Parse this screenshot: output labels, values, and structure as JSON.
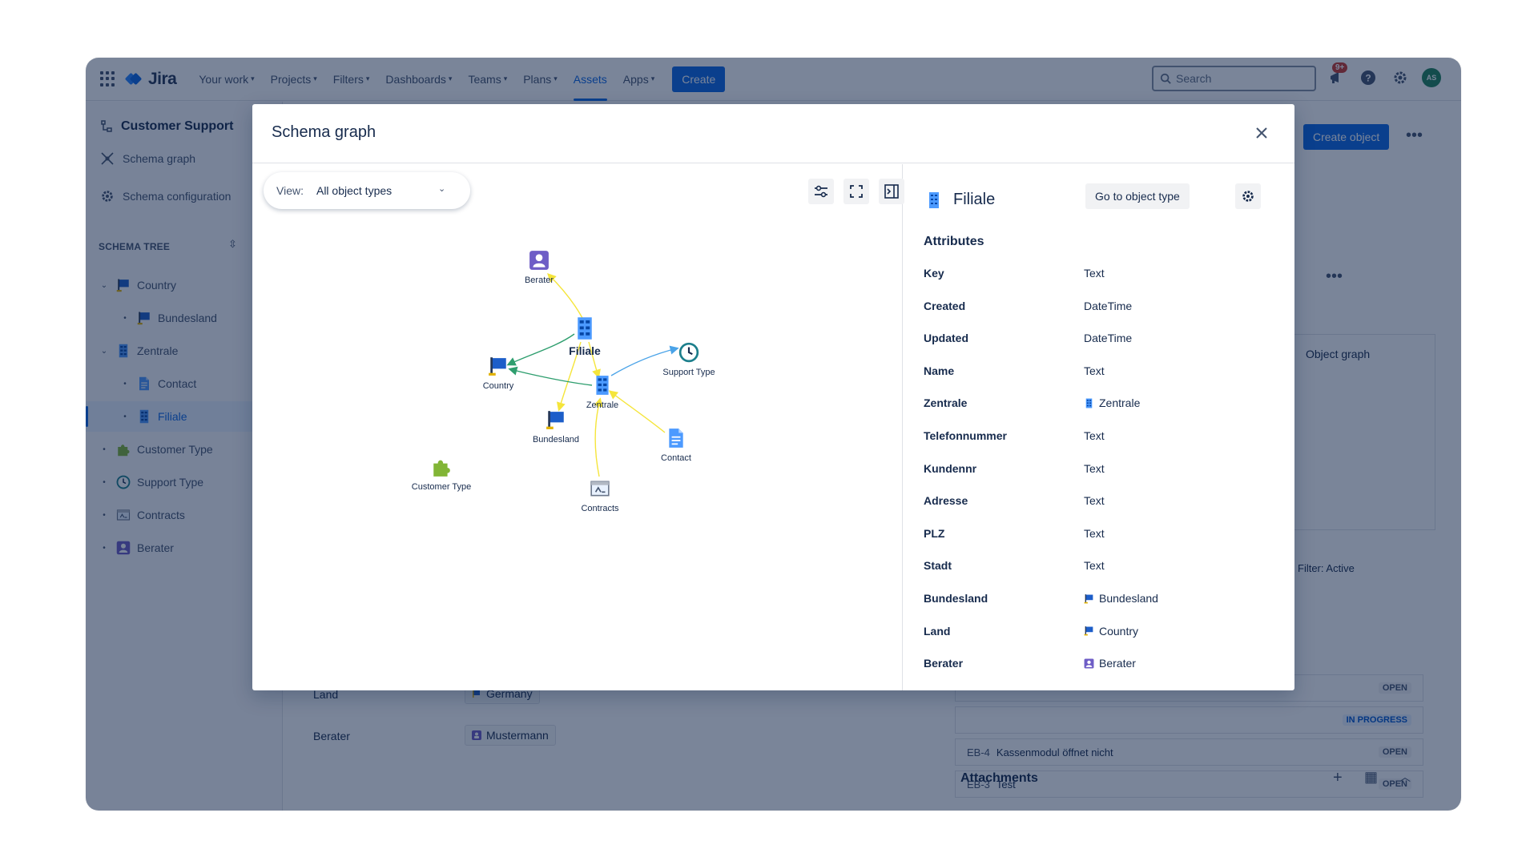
{
  "nav": {
    "app_name": "Jira",
    "items": [
      {
        "label": "Your work",
        "chevron": true
      },
      {
        "label": "Projects",
        "chevron": true
      },
      {
        "label": "Filters",
        "chevron": true
      },
      {
        "label": "Dashboards",
        "chevron": true
      },
      {
        "label": "Teams",
        "chevron": true
      },
      {
        "label": "Plans",
        "chevron": true
      },
      {
        "label": "Assets",
        "chevron": false,
        "active": true
      },
      {
        "label": "Apps",
        "chevron": true
      }
    ],
    "create_label": "Create",
    "search_placeholder": "Search",
    "notifications_badge": "9+",
    "avatar_initials": "AS"
  },
  "sidebar": {
    "project": "Customer Support",
    "links": [
      "Schema graph",
      "Schema configuration"
    ],
    "tree_header": "SCHEMA TREE",
    "tree": [
      {
        "label": "Country",
        "indent": 0,
        "twisty": "v",
        "icon": "flag-icon"
      },
      {
        "label": "Bundesland",
        "indent": 1,
        "twisty": "•",
        "icon": "flag-icon"
      },
      {
        "label": "Zentrale",
        "indent": 0,
        "twisty": "v",
        "icon": "building-icon"
      },
      {
        "label": "Contact",
        "indent": 1,
        "twisty": "•",
        "icon": "document-icon"
      },
      {
        "label": "Filiale",
        "indent": 1,
        "twisty": "•",
        "icon": "building-icon",
        "selected": true
      },
      {
        "label": "Customer Type",
        "indent": 0,
        "twisty": "•",
        "icon": "puzzle-icon"
      },
      {
        "label": "Support Type",
        "indent": 0,
        "twisty": "•",
        "icon": "clock-icon"
      },
      {
        "label": "Contracts",
        "indent": 0,
        "twisty": "•",
        "icon": "contract-icon"
      },
      {
        "label": "Berater",
        "indent": 0,
        "twisty": "•",
        "icon": "person-icon"
      }
    ]
  },
  "background": {
    "create_object": "Create object",
    "object_graph": "Object graph",
    "filter_label": "Filter: Active",
    "issues": [
      {
        "key": "",
        "title": "",
        "status": "OPEN"
      },
      {
        "key": "",
        "title": "",
        "status": "IN PROGRESS"
      },
      {
        "key": "EB-4",
        "title": "Kassenmodul öffnet nicht",
        "status": "OPEN"
      },
      {
        "key": "EB-3",
        "title": "Test",
        "status": "OPEN"
      }
    ],
    "fields": [
      {
        "label": "Land",
        "value": "Germany"
      },
      {
        "label": "Berater",
        "value": "Mustermann"
      }
    ],
    "attachments": "Attachments"
  },
  "modal": {
    "title": "Schema graph",
    "view_label": "View:",
    "view_value": "All object types",
    "nodes": [
      {
        "label": "Berater",
        "icon": "person-icon",
        "big": false
      },
      {
        "label": "Filiale",
        "icon": "building-icon",
        "big": true
      },
      {
        "label": "Support Type",
        "icon": "clock-icon",
        "big": false
      },
      {
        "label": "Country",
        "icon": "flag-icon",
        "big": false
      },
      {
        "label": "Zentrale",
        "icon": "building-icon",
        "big": false
      },
      {
        "label": "Bundesland",
        "icon": "flag-icon",
        "big": false
      },
      {
        "label": "Contact",
        "icon": "document-icon",
        "big": false
      },
      {
        "label": "Customer Type",
        "icon": "puzzle-icon",
        "big": false
      },
      {
        "label": "Contracts",
        "icon": "contract-icon",
        "big": false
      }
    ],
    "detail": {
      "title": "Filiale",
      "goto_label": "Go to object type",
      "attributes_header": "Attributes",
      "attributes": [
        {
          "key": "Key",
          "value": "Text",
          "icon": ""
        },
        {
          "key": "Created",
          "value": "DateTime",
          "icon": ""
        },
        {
          "key": "Updated",
          "value": "DateTime",
          "icon": ""
        },
        {
          "key": "Name",
          "value": "Text",
          "icon": ""
        },
        {
          "key": "Zentrale",
          "value": "Zentrale",
          "icon": "building-icon"
        },
        {
          "key": "Telefonnummer",
          "value": "Text",
          "icon": ""
        },
        {
          "key": "Kundennr",
          "value": "Text",
          "icon": ""
        },
        {
          "key": "Adresse",
          "value": "Text",
          "icon": ""
        },
        {
          "key": "PLZ",
          "value": "Text",
          "icon": ""
        },
        {
          "key": "Stadt",
          "value": "Text",
          "icon": ""
        },
        {
          "key": "Bundesland",
          "value": "Bundesland",
          "icon": "flag-icon"
        },
        {
          "key": "Land",
          "value": "Country",
          "icon": "flag-icon"
        },
        {
          "key": "Berater",
          "value": "Berater",
          "icon": "person-icon"
        }
      ]
    }
  },
  "colors": {
    "brand": "#0c66e4",
    "edge_yellow": "#f5e53b",
    "edge_green": "#2e9e6e",
    "edge_blue": "#4aa3e8"
  }
}
